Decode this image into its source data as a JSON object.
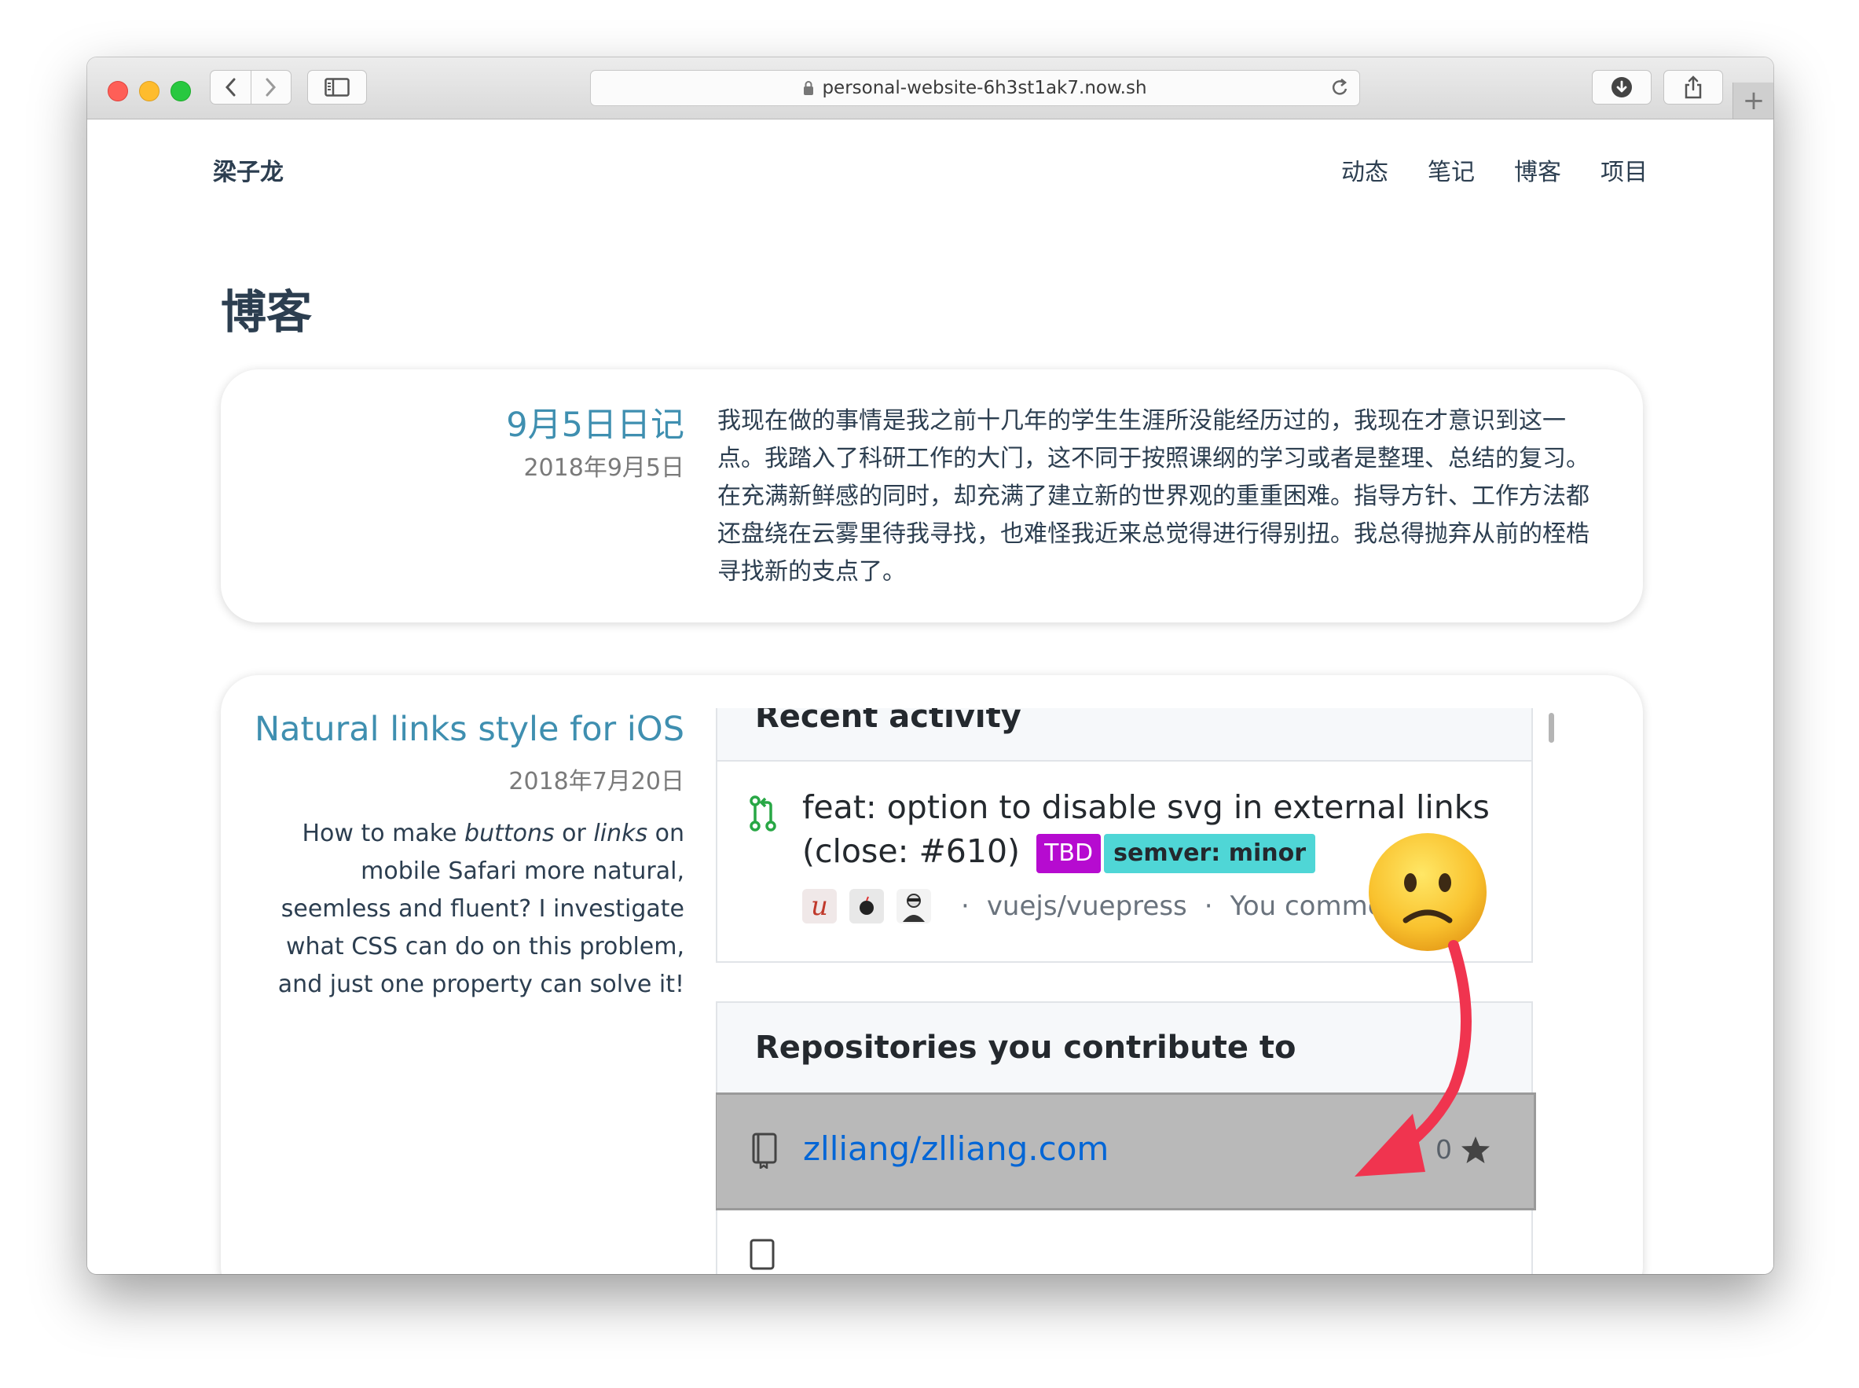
{
  "browser": {
    "url": "personal-website-6h3st1ak7.now.sh",
    "new_tab_label": "+"
  },
  "site": {
    "name": "梁子龙",
    "nav": [
      "动态",
      "笔记",
      "博客",
      "项目"
    ]
  },
  "page_title": "博客",
  "posts": [
    {
      "title": "9月5日日记",
      "date": "2018年9月5日",
      "excerpt": "我现在做的事情是我之前十几年的学生生涯所没能经历过的，我现在才意识到这一点。我踏入了科研工作的大门，这不同于按照课纲的学习或者是整理、总结的复习。在充满新鲜感的同时，却充满了建立新的世界观的重重困难。指导方针、工作方法都还盘绕在云雾里待我寻找，也难怪我近来总觉得进行得别扭。我总得抛弃从前的桎梏寻找新的支点了。"
    },
    {
      "title": "Natural links style for iOS",
      "date": "2018年7月20日",
      "excerpt_parts": [
        "How to make ",
        "buttons",
        " or ",
        "links",
        " on mobile Safari more natural, seemless and fluent? I investigate what CSS can do on this problem, and just one property can solve it!"
      ]
    }
  ],
  "embedded_screenshot": {
    "activity_heading": "Recent activity",
    "pr_title": "feat: option to disable svg in external links (close: #610)",
    "labels": [
      {
        "text": "TBD",
        "color": "#b60bd0"
      },
      {
        "text": "semver: minor",
        "color": "#4fd6d6"
      }
    ],
    "avatar_letter": "u",
    "repo_ref": "vuejs/vuepress",
    "activity_note": "You commented",
    "separator": "·",
    "repos_heading": "Repositories you contribute to",
    "repo_name": "zlliang/zlliang.com",
    "star_count": "0",
    "highlight_color": "#b9b9b9",
    "reaction_emoji": "confused-face-icon",
    "arrow_color": "#f0344f"
  }
}
